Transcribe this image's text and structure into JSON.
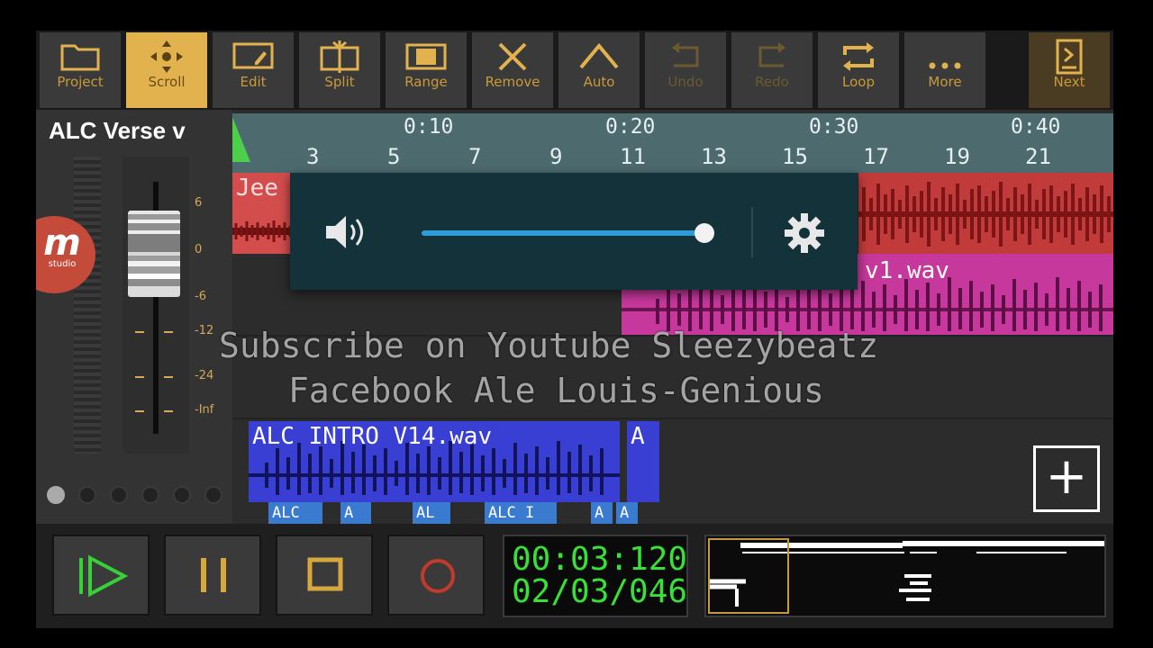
{
  "toolbar": {
    "items": [
      {
        "label": "Project",
        "icon": "folder-icon"
      },
      {
        "label": "Scroll",
        "icon": "scroll-icon",
        "active": true
      },
      {
        "label": "Edit",
        "icon": "edit-icon"
      },
      {
        "label": "Split",
        "icon": "split-icon"
      },
      {
        "label": "Range",
        "icon": "range-icon"
      },
      {
        "label": "Remove",
        "icon": "close-icon"
      },
      {
        "label": "Auto",
        "icon": "automation-icon"
      },
      {
        "label": "Undo",
        "icon": "undo-icon",
        "disabled": true
      },
      {
        "label": "Redo",
        "icon": "redo-icon",
        "disabled": true
      },
      {
        "label": "Loop",
        "icon": "loop-icon"
      },
      {
        "label": "More",
        "icon": "more-icon"
      }
    ],
    "next_label": "Next"
  },
  "track_panel": {
    "title": "ALC Verse v",
    "db_scale": [
      "6",
      "0",
      "-6",
      "-12",
      "-24",
      "-Inf"
    ],
    "logo_letter": "m",
    "logo_sub": "studio"
  },
  "timeline": {
    "time_labels": [
      "0:10",
      "0:20",
      "0:30",
      "0:40"
    ],
    "bar_labels": [
      "3",
      "5",
      "7",
      "9",
      "11",
      "13",
      "15",
      "17",
      "19",
      "21"
    ]
  },
  "clips": {
    "red_left": "Jee",
    "magenta": "v1.wav",
    "blue": "ALC INTRO V14.wav",
    "blue_small": "A",
    "mini": [
      "ALC",
      "A",
      "AL",
      "ALC I",
      "A",
      "A"
    ]
  },
  "volume_popup": {
    "level": 0.95
  },
  "overlay": {
    "line1": "Subscribe on Youtube Sleezybeatz",
    "line2": "Facebook Ale Louis-Genious"
  },
  "transport": {
    "time": "00:03:120",
    "position": "02/03/046"
  },
  "colors": {
    "accent": "#e2b24e",
    "clock_green": "#38e038",
    "timeline": "#4d6b6f",
    "clip_red": "#c23b3b",
    "clip_magenta": "#c7389c",
    "clip_blue": "#3a3fd4",
    "slider_blue": "#2e9cd6"
  }
}
